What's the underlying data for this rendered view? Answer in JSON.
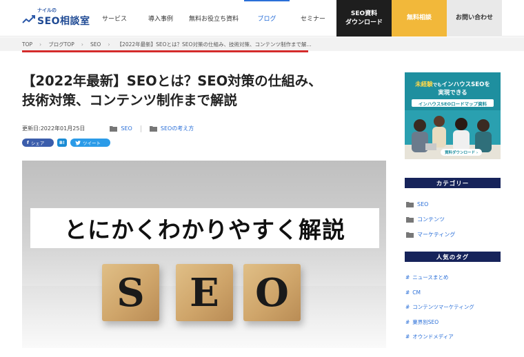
{
  "header": {
    "logo_kicker": "ナイルの",
    "logo_name": "SEO相談室",
    "nav": [
      {
        "label": "サービス",
        "active": false
      },
      {
        "label": "導入事例",
        "active": false
      },
      {
        "label": "無料お役立ち資料",
        "active": false
      },
      {
        "label": "ブログ",
        "active": true
      },
      {
        "label": "セミナー",
        "active": false
      }
    ],
    "cta_download_line1": "SEO資料",
    "cta_download_line2": "ダウンロード",
    "cta_free": "無料相談",
    "cta_contact": "お問い合わせ"
  },
  "breadcrumb": [
    "TOP",
    "ブログTOP",
    "SEO",
    "【2022年最新】SEOとは？SEO対策の仕組み、技術対策、コンテンツ制作まで解..."
  ],
  "article": {
    "title_line1": "【2022年最新】SEOとは？SEO対策の仕組み、",
    "title_line2": "技術対策、コンテンツ制作まで解説",
    "updated": "更新日:2022年01月25日",
    "categories": [
      "SEO",
      "SEOの考え方"
    ],
    "share": {
      "facebook": "シェア",
      "hatena": "B!",
      "twitter": "ツイート"
    },
    "hero_banner": "とにかくわかりやすく解説",
    "hero_blocks": [
      "S",
      "E",
      "O"
    ]
  },
  "sidebar": {
    "ad": {
      "line1_pre": "未経験",
      "line1_small": "でも",
      "line1_post": "インハウスSEOを",
      "line1b": "実現できる",
      "line2": "インハウスSEOロードマップ資料",
      "button": "資料ダウンロード ›"
    },
    "category_heading": "カテゴリー",
    "categories": [
      "SEO",
      "コンテンツ",
      "マーケティング"
    ],
    "tag_heading": "人気のタグ",
    "tags": [
      "ニュースまとめ",
      "CM",
      "コンテンツマーケティング",
      "業界別SEO",
      "オウンドメディア"
    ]
  },
  "colors": {
    "accent_blue": "#2a6fd8",
    "breadcrumb_underline": "#d42b2b",
    "cta_dark": "#1e1e1e",
    "cta_yellow": "#f2b83a",
    "sidebar_heading": "#16235a",
    "ad_teal": "#1e8f9f"
  },
  "icons": [
    "logo-chart-icon",
    "folder-icon",
    "facebook-icon",
    "hatena-icon",
    "twitter-icon",
    "chevron-right-icon"
  ]
}
